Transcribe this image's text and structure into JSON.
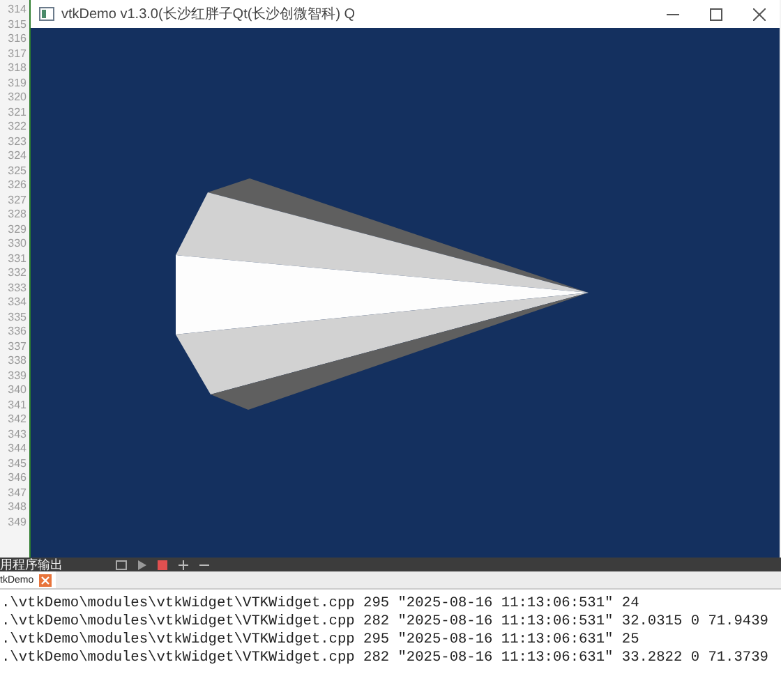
{
  "editor_gutter": {
    "line_numbers": [
      "314",
      "315",
      "316",
      "317",
      "318",
      "319",
      "320",
      "321",
      "322",
      "323",
      "324",
      "325",
      "326",
      "327",
      "328",
      "329",
      "330",
      "331",
      "332",
      "333",
      "334",
      "335",
      "336",
      "337",
      "338",
      "339",
      "340",
      "341",
      "342",
      "343",
      "344",
      "345",
      "346",
      "347",
      "348",
      "349"
    ]
  },
  "window": {
    "title": "vtkDemo v1.3.0(长沙红胖子Qt(长沙创微智科) Q"
  },
  "output_pane": {
    "title": "用程序输出",
    "tabs": [
      {
        "label": "tkDemo",
        "selected": true
      }
    ],
    "lines": [
      ".\\vtkDemo\\modules\\vtkWidget\\VTKWidget.cpp 295 \"2025-08-16 11:13:06:531\" 24",
      ".\\vtkDemo\\modules\\vtkWidget\\VTKWidget.cpp 282 \"2025-08-16 11:13:06:531\" 32.0315 0 71.9439",
      ".\\vtkDemo\\modules\\vtkWidget\\VTKWidget.cpp 295 \"2025-08-16 11:13:06:631\" 25",
      ".\\vtkDemo\\modules\\vtkWidget\\VTKWidget.cpp 282 \"2025-08-16 11:13:06:631\" 33.2822 0 71.3739"
    ]
  }
}
